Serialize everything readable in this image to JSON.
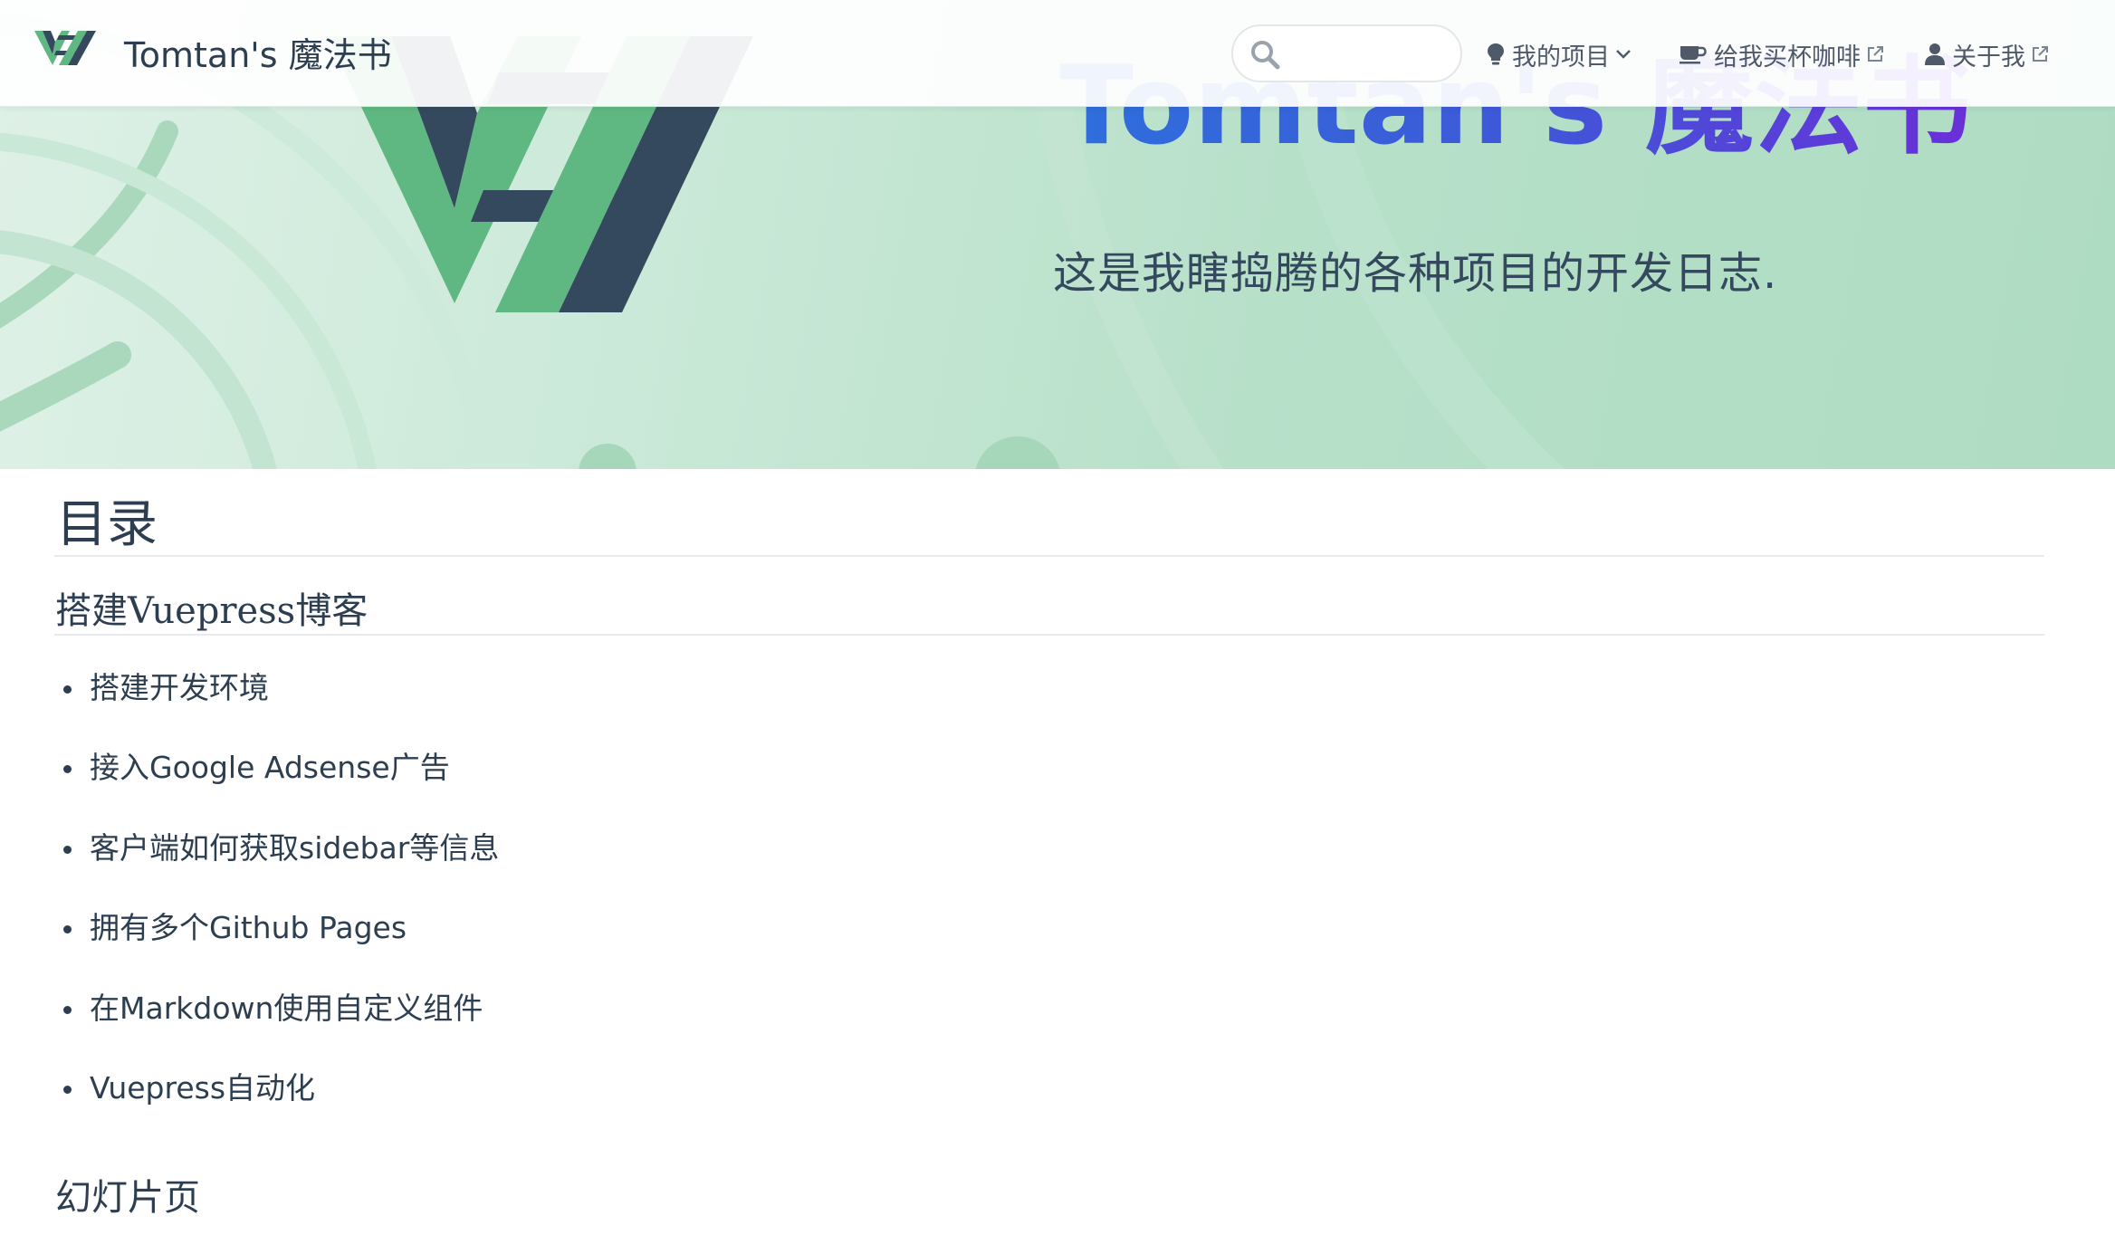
{
  "navbar": {
    "logo_icon": "vh-logo-icon",
    "site_title": "Tomtan's 魔法书",
    "search": {
      "value": "",
      "placeholder": ""
    },
    "items": [
      {
        "label": "我的项目",
        "icon": "lightbulb-icon",
        "tail": "chevron-down-icon"
      },
      {
        "label": "给我买杯咖啡",
        "icon": "coffee-icon",
        "tail": "external-link-icon"
      },
      {
        "label": "关于我",
        "icon": "user-icon",
        "tail": "external-link-icon"
      }
    ]
  },
  "hero": {
    "title": "Tomtan's 魔法书",
    "tagline": "这是我瞎捣腾的各种项目的开发日志."
  },
  "content": {
    "toc_heading": "目录",
    "sections": [
      {
        "title": "搭建Vuepress博客",
        "links": [
          "搭建开发环境",
          "接入Google Adsense广告",
          "客户端如何获取sidebar等信息",
          "拥有多个Github Pages",
          "在Markdown使用自定义组件",
          "Vuepress自动化"
        ]
      },
      {
        "title": "幻灯片页",
        "links": []
      }
    ]
  },
  "colors": {
    "brand_green": "#5fb781",
    "brand_dark": "#35495e",
    "text": "#2c3e50",
    "hero_title_start": "#2e6fdc",
    "hero_title_end": "#6a2fd8"
  }
}
